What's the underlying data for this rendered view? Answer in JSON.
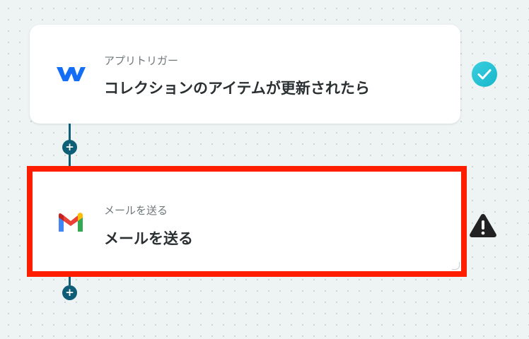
{
  "trigger_step": {
    "subtitle": "アプリトリガー",
    "title": "コレクションのアイテムが更新されたら",
    "app_icon": "webflow-icon",
    "status_icon": "check-icon",
    "accent_color": "#146ef5"
  },
  "action_step": {
    "subtitle": "メールを送る",
    "title": "メールを送る",
    "app_icon": "gmail-icon",
    "status_icon": "warning-icon",
    "highlight_color": "#ff1d00"
  },
  "connector": {
    "add_label": "+",
    "color": "#0f5e77"
  },
  "colors": {
    "check": "#22c3d6",
    "warning": "#222222"
  }
}
